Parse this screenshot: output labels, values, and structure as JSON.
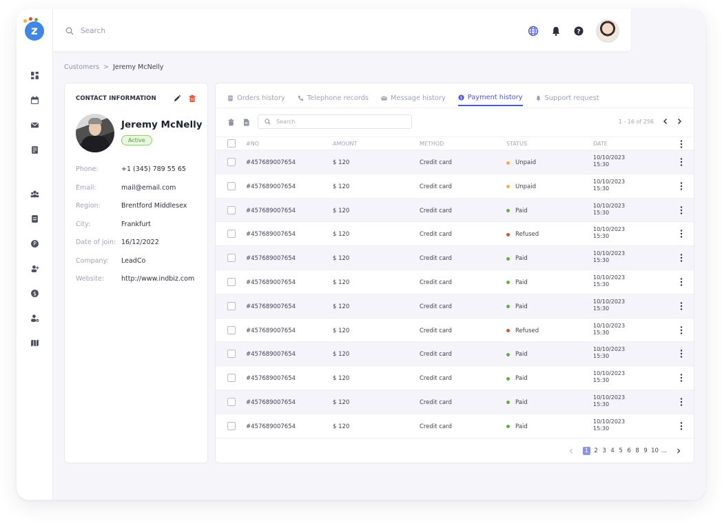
{
  "topbar": {
    "search_placeholder": "Search"
  },
  "breadcrumb": {
    "parent": "Customers",
    "separator": ">",
    "current": "Jeremy McNelly"
  },
  "contact": {
    "title": "CONTACT INFORMATION",
    "name": "Jeremy McNelly",
    "status": "Active",
    "fields": [
      {
        "label": "Phone:",
        "value": "+1 (345) 789 55 65"
      },
      {
        "label": "Email:",
        "value": "mail@email.com"
      },
      {
        "label": "Region:",
        "value": "Brentford Middlesex"
      },
      {
        "label": "City:",
        "value": "Frankfurt"
      },
      {
        "label": "Date of join:",
        "value": "16/12/2022"
      },
      {
        "label": "Company:",
        "value": "LeadCo"
      },
      {
        "label": "Website:",
        "value": "http://www.indbiz.com"
      }
    ]
  },
  "tabs": [
    {
      "label": "Orders history",
      "icon": "document-icon"
    },
    {
      "label": "Telephone records",
      "icon": "phone-icon"
    },
    {
      "label": "Message history",
      "icon": "mail-icon"
    },
    {
      "label": "Payment history",
      "icon": "dollar-icon",
      "active": true
    },
    {
      "label": "Support request",
      "icon": "bell-icon"
    }
  ],
  "table": {
    "search_placeholder": "Search",
    "range": "1 - 16 of 256",
    "columns": [
      "#NO",
      "AMOUNT",
      "METHOD",
      "STATUS",
      "DATE"
    ],
    "rows": [
      {
        "no": "#457689007654",
        "amount": "$ 120",
        "method": "Credit card",
        "status": "Unpaid",
        "date": "10/10/2023",
        "time": "15:30"
      },
      {
        "no": "#457689007654",
        "amount": "$ 120",
        "method": "Credit card",
        "status": "Unpaid",
        "date": "10/10/2023",
        "time": "15:30"
      },
      {
        "no": "#457689007654",
        "amount": "$ 120",
        "method": "Credit card",
        "status": "Paid",
        "date": "10/10/2023",
        "time": "15:30"
      },
      {
        "no": "#457689007654",
        "amount": "$ 120",
        "method": "Credit card",
        "status": "Refused",
        "date": "10/10/2023",
        "time": "15:30"
      },
      {
        "no": "#457689007654",
        "amount": "$ 120",
        "method": "Credit card",
        "status": "Paid",
        "date": "10/10/2023",
        "time": "15:30"
      },
      {
        "no": "#457689007654",
        "amount": "$ 120",
        "method": "Credit card",
        "status": "Paid",
        "date": "10/10/2023",
        "time": "15:30"
      },
      {
        "no": "#457689007654",
        "amount": "$ 120",
        "method": "Credit card",
        "status": "Paid",
        "date": "10/10/2023",
        "time": "15:30"
      },
      {
        "no": "#457689007654",
        "amount": "$ 120",
        "method": "Credit card",
        "status": "Refused",
        "date": "10/10/2023",
        "time": "15:30"
      },
      {
        "no": "#457689007654",
        "amount": "$ 120",
        "method": "Credit card",
        "status": "Paid",
        "date": "10/10/2023",
        "time": "15:30"
      },
      {
        "no": "#457689007654",
        "amount": "$ 120",
        "method": "Credit card",
        "status": "Paid",
        "date": "10/10/2023",
        "time": "15:30"
      },
      {
        "no": "#457689007654",
        "amount": "$ 120",
        "method": "Credit card",
        "status": "Paid",
        "date": "10/10/2023",
        "time": "15:30"
      },
      {
        "no": "#457689007654",
        "amount": "$ 120",
        "method": "Credit card",
        "status": "Paid",
        "date": "10/10/2023",
        "time": "15:30"
      }
    ],
    "pagination": {
      "pages": [
        "1",
        "2",
        "3",
        "4",
        "5",
        "6",
        "8",
        "9",
        "10",
        "..."
      ],
      "current": "1"
    }
  },
  "colors": {
    "accent": "#4a55d8",
    "paid": "#5cb23a",
    "unpaid": "#f2b233",
    "refused": "#e24a2e",
    "delete": "#e24a2e"
  }
}
